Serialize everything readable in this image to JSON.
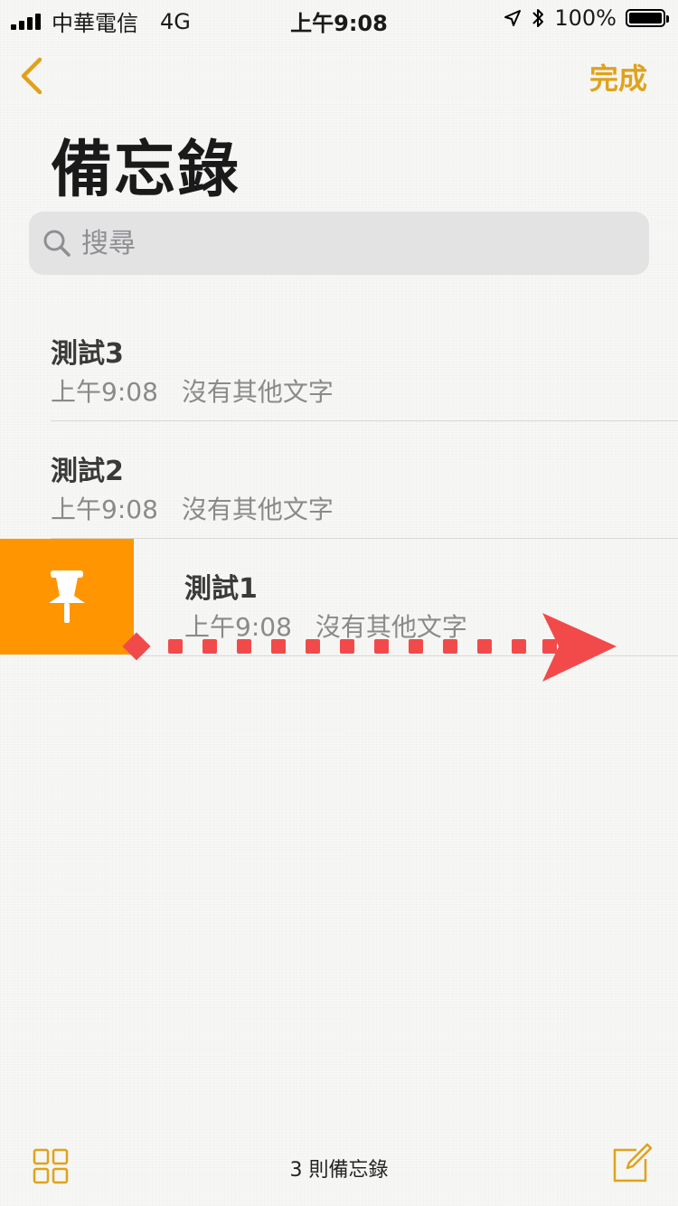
{
  "status_bar": {
    "carrier": "中華電信",
    "network": "4G",
    "time": "上午9:08",
    "battery": "100%"
  },
  "nav": {
    "back_icon": "chevron-left-icon",
    "done_label": "完成"
  },
  "page_title": "備忘錄",
  "search": {
    "placeholder": "搜尋"
  },
  "notes": [
    {
      "title": "測試3",
      "time": "上午9:08",
      "preview": "沒有其他文字"
    },
    {
      "title": "測試2",
      "time": "上午9:08",
      "preview": "沒有其他文字"
    },
    {
      "title": "測試1",
      "time": "上午9:08",
      "preview": "沒有其他文字"
    }
  ],
  "swipe_action": {
    "icon": "pin-icon",
    "color": "#ff9500"
  },
  "annotation": {
    "icon": "swipe-right-arrow-icon",
    "color": "#f24a4a"
  },
  "toolbar": {
    "count_label": "3 則備忘錄",
    "left_icon": "grid-icon",
    "right_icon": "compose-icon"
  },
  "colors": {
    "accent": "#e0a21b",
    "pin": "#ff9500",
    "arrow": "#f24a4a"
  }
}
